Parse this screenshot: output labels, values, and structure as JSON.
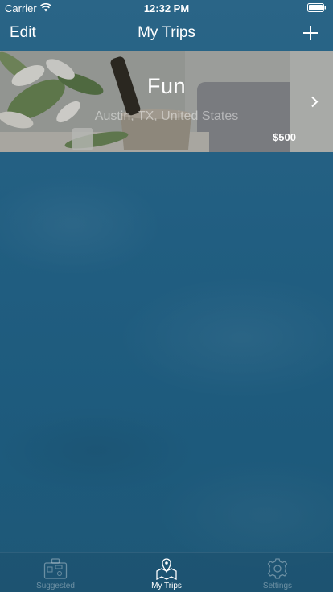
{
  "status_bar": {
    "carrier": "Carrier",
    "time": "12:32 PM"
  },
  "nav": {
    "edit_label": "Edit",
    "title": "My Trips",
    "add_icon": "plus-icon"
  },
  "trips": [
    {
      "name": "Fun",
      "location": "Austin, TX, United States",
      "budget": "$500"
    }
  ],
  "tabs": [
    {
      "label": "Suggested",
      "icon": "suitcase-icon",
      "active": false
    },
    {
      "label": "My Trips",
      "icon": "map-pin-icon",
      "active": true
    },
    {
      "label": "Settings",
      "icon": "gear-icon",
      "active": false
    }
  ],
  "colors": {
    "background": "#215e81",
    "text": "#ffffff",
    "tab_inactive": "rgba(255,255,255,0.35)"
  }
}
